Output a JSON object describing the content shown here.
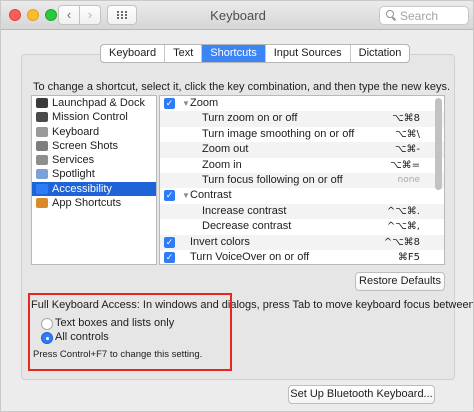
{
  "window": {
    "title": "Keyboard"
  },
  "search": {
    "placeholder": "Search"
  },
  "colors": {
    "accent": "#3d85f4",
    "selection": "#1f63d9",
    "highlight_box": "#e8261f"
  },
  "tabs": [
    {
      "label": "Keyboard",
      "active": false
    },
    {
      "label": "Text",
      "active": false
    },
    {
      "label": "Shortcuts",
      "active": true
    },
    {
      "label": "Input Sources",
      "active": false
    },
    {
      "label": "Dictation",
      "active": false
    }
  ],
  "instructions": "To change a shortcut, select it, click the key combination, and then type the new keys.",
  "categories": [
    {
      "label": "Launchpad & Dock",
      "icon": "launchpad-icon",
      "color": "#3a3a3a",
      "selected": false
    },
    {
      "label": "Mission Control",
      "icon": "mission-control-icon",
      "color": "#4a4a4a",
      "selected": false
    },
    {
      "label": "Keyboard",
      "icon": "keyboard-icon",
      "color": "#9a9a9a",
      "selected": false
    },
    {
      "label": "Screen Shots",
      "icon": "screenshot-icon",
      "color": "#7d7d7d",
      "selected": false
    },
    {
      "label": "Services",
      "icon": "gear-icon",
      "color": "#8e8e8e",
      "selected": false
    },
    {
      "label": "Spotlight",
      "icon": "spotlight-icon",
      "color": "#7aa0d8",
      "selected": false
    },
    {
      "label": "Accessibility",
      "icon": "accessibility-icon",
      "color": "#2e7cf6",
      "selected": true
    },
    {
      "label": "App Shortcuts",
      "icon": "app-shortcuts-icon",
      "color": "#d98b2b",
      "selected": false
    }
  ],
  "shortcuts": [
    {
      "label": "Zoom",
      "key": "",
      "checkbox": true,
      "group": true,
      "indent": 1
    },
    {
      "label": "Turn zoom on or off",
      "key": "⌥⌘8",
      "checkbox": false,
      "group": false,
      "indent": 2
    },
    {
      "label": "Turn image smoothing on or off",
      "key": "⌥⌘\\",
      "checkbox": false,
      "group": false,
      "indent": 2
    },
    {
      "label": "Zoom out",
      "key": "⌥⌘-",
      "checkbox": false,
      "group": false,
      "indent": 2
    },
    {
      "label": "Zoom in",
      "key": "⌥⌘=",
      "checkbox": false,
      "group": false,
      "indent": 2
    },
    {
      "label": "Turn focus following on or off",
      "key": "none",
      "checkbox": false,
      "group": false,
      "indent": 2
    },
    {
      "label": "Contrast",
      "key": "",
      "checkbox": true,
      "group": true,
      "indent": 1
    },
    {
      "label": "Increase contrast",
      "key": "^⌥⌘.",
      "checkbox": false,
      "group": false,
      "indent": 2
    },
    {
      "label": "Decrease contrast",
      "key": "^⌥⌘,",
      "checkbox": false,
      "group": false,
      "indent": 2
    },
    {
      "label": "Invert colors",
      "key": "^⌥⌘8",
      "checkbox": true,
      "group": false,
      "indent": 0
    },
    {
      "label": "Turn VoiceOver on or off",
      "key": "⌘F5",
      "checkbox": true,
      "group": false,
      "indent": 0
    }
  ],
  "buttons": {
    "restore_defaults": "Restore Defaults",
    "bluetooth": "Set Up Bluetooth Keyboard..."
  },
  "full_keyboard_access": {
    "label": "Full Keyboard Access: In windows and dialogs, press Tab to move keyboard focus between:",
    "options": [
      {
        "label": "Text boxes and lists only",
        "selected": false
      },
      {
        "label": "All controls",
        "selected": true
      }
    ],
    "note": "Press Control+F7 to change this setting."
  }
}
